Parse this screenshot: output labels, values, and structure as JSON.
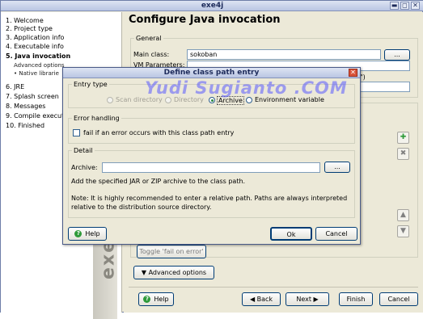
{
  "window": {
    "title": "exe4j",
    "minimize": "▬",
    "maximize": "◻",
    "close": "✕"
  },
  "sidebar": {
    "steps": [
      {
        "label": "1. Welcome"
      },
      {
        "label": "2. Project type"
      },
      {
        "label": "3. Application info"
      },
      {
        "label": "4. Executable info"
      },
      {
        "label": "5. Java invocation"
      },
      {
        "label": "6. JRE"
      },
      {
        "label": "7. Splash screen"
      },
      {
        "label": "8. Messages"
      },
      {
        "label": "9. Compile executa"
      },
      {
        "label": "10. Finished"
      }
    ],
    "substeps": [
      "Advanced options",
      "• Native librarie"
    ],
    "logo": "exe4j"
  },
  "main": {
    "title": "Configure Java invocation",
    "general_legend": "General",
    "main_class_label": "Main class:",
    "main_class_value": "sokoban",
    "main_class_browse": "...",
    "vm_params_label": "VM Parameters:",
    "quote_fragment": "\")",
    "toggle_fail_label": "Toggle 'fail on error'",
    "advanced_options_label": "Advanced options",
    "nav": {
      "help": "Help",
      "back": "Back",
      "next": "Next",
      "finish": "Finish",
      "cancel": "Cancel"
    }
  },
  "dialog": {
    "title": "Define class path entry",
    "close": "✕",
    "entry_type_legend": "Entry type",
    "entry_types": [
      "Scan directory",
      "Directory",
      "Archive",
      "Environment variable"
    ],
    "selected_entry_type": "Archive",
    "error_legend": "Error handling",
    "fail_checkbox_label": "fail if an error occurs with this class path entry",
    "detail_legend": "Detail",
    "archive_label": "Archive:",
    "archive_value": "",
    "browse": "...",
    "hint": "Add the specified JAR or ZIP archive to the class path.",
    "note": "Note: It is highly recommended to enter a relative path. Paths are always interpreted relative to the distribution source directory.",
    "help": "Help",
    "ok": "Ok",
    "cancel": "Cancel"
  },
  "watermark": "Yudi Sugianto .COM",
  "colors": {
    "window_bg": "#ECE9D8",
    "titlebar": "#b9c5e3",
    "watermark": "#5a5aff",
    "add_icon": "#2e9a3a",
    "remove_icon": "#808080"
  },
  "icons": [
    "plus-icon",
    "x-icon",
    "arrow-up-icon",
    "arrow-down-icon",
    "help-icon",
    "triangle-down-icon"
  ]
}
